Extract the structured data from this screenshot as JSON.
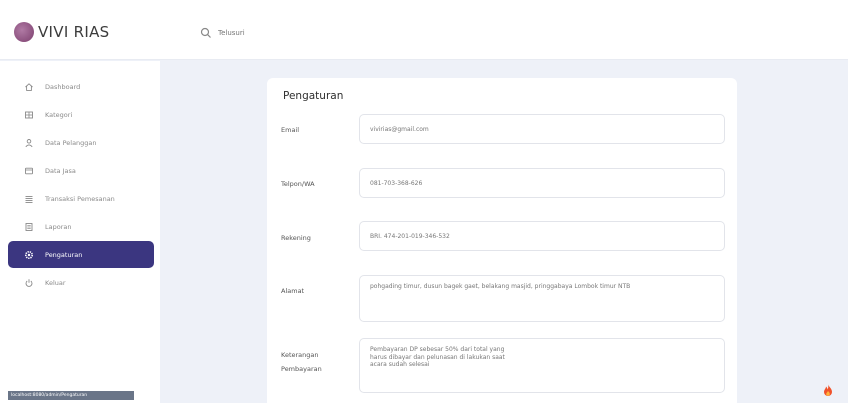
{
  "brand": {
    "name": "VIVI RIAS",
    "color": "#8a4b7e"
  },
  "search": {
    "placeholder": "Telusuri"
  },
  "sidebar": {
    "items": [
      {
        "label": "Dashboard",
        "icon": "home-icon"
      },
      {
        "label": "Kategori",
        "icon": "grid-icon"
      },
      {
        "label": "Data Pelanggan",
        "icon": "user-icon"
      },
      {
        "label": "Data Jasa",
        "icon": "box-icon"
      },
      {
        "label": "Transaksi Pemesanan",
        "icon": "list-icon"
      },
      {
        "label": "Laporan",
        "icon": "report-icon"
      },
      {
        "label": "Pengaturan",
        "icon": "settings-icon",
        "active": true
      },
      {
        "label": "Keluar",
        "icon": "power-icon"
      }
    ],
    "active_color": "#3b3680"
  },
  "footer": {
    "status_text": "localhost:8080/admin/Pengaturan"
  },
  "settings": {
    "title": "Pengaturan",
    "email": {
      "label": "Email",
      "value": "vivirias@gmail.com"
    },
    "phone": {
      "label": "Telpon/WA",
      "value": "081-703-368-626"
    },
    "account": {
      "label": "Rekening",
      "value": "BRI. 474-201-019-346-532"
    },
    "address": {
      "label": "Alamat",
      "value": "pohgading timur, dusun bagek gaet, belakang masjid, pringgabaya Lombok timur NTB"
    },
    "payment_note": {
      "label_line1": "Keterangan",
      "label_line2": "Pembayaran",
      "value": "Pembayaran DP sebesar 50% dari total yang\nharus dibayar dan pelunasan di lakukan saat\nacara sudah selesai"
    }
  }
}
